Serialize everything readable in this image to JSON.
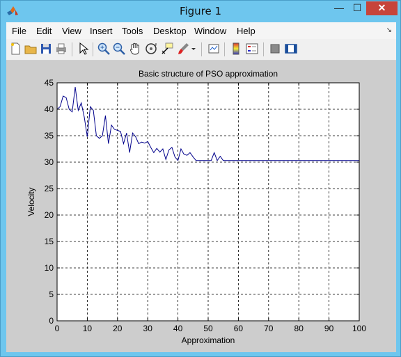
{
  "window": {
    "title": "Figure 1",
    "minimize_glyph": "—",
    "maximize_glyph": "☐",
    "close_glyph": "✕"
  },
  "menu": {
    "items": [
      "File",
      "Edit",
      "View",
      "Insert",
      "Tools",
      "Desktop",
      "Window",
      "Help"
    ],
    "dock_glyph": "↘"
  },
  "toolbar": {
    "icons": [
      "new-figure-icon",
      "open-file-icon",
      "save-icon",
      "print-icon",
      "edit-plot-arrow-icon",
      "zoom-in-icon",
      "zoom-out-icon",
      "pan-hand-icon",
      "rotate-3d-icon",
      "data-cursor-icon",
      "brush-icon",
      "brush-dropdown-icon",
      "link-plot-icon",
      "colorbar-icon",
      "legend-icon",
      "hide-plot-tools-icon",
      "show-plot-tools-icon"
    ]
  },
  "colors": {
    "line": "#00008b",
    "baseline": "#008000",
    "axes_bg": "#ffffff",
    "figure_bg": "#cdcdcd"
  },
  "chart_data": {
    "type": "line",
    "title": "Basic structure of PSO approximation",
    "xlabel": "Approximation",
    "ylabel": "Velocity",
    "xlim": [
      0,
      100
    ],
    "ylim": [
      0,
      45
    ],
    "xticks": [
      0,
      10,
      20,
      30,
      40,
      50,
      60,
      70,
      80,
      90,
      100
    ],
    "yticks": [
      0,
      5,
      10,
      15,
      20,
      25,
      30,
      35,
      40,
      45
    ],
    "grid": true,
    "grid_style": "dashed",
    "series": [
      {
        "color": "#00008b",
        "x": [
          0,
          1,
          2,
          3,
          4,
          5,
          6,
          7,
          8,
          9,
          10,
          11,
          12,
          13,
          14,
          15,
          16,
          17,
          18,
          19,
          20,
          21,
          22,
          23,
          24,
          25,
          26,
          27,
          28,
          29,
          30,
          31,
          32,
          33,
          34,
          35,
          36,
          37,
          38,
          39,
          40,
          41,
          42,
          43,
          44,
          45,
          46,
          47,
          48,
          49,
          50,
          51,
          52,
          53,
          54,
          55,
          56,
          57,
          58,
          59,
          60,
          65,
          70,
          75,
          80,
          85,
          90,
          95,
          100
        ],
        "y": [
          40,
          40.5,
          42.5,
          42.2,
          40,
          39.5,
          44.2,
          39.8,
          41.2,
          38.5,
          34.8,
          40.5,
          39.8,
          35,
          34.5,
          35,
          38.8,
          33.5,
          37,
          36.2,
          36,
          35.8,
          33.5,
          35.5,
          31.8,
          35.5,
          34.8,
          33.5,
          33.8,
          33.6,
          33.9,
          32.8,
          31.8,
          32.6,
          31.9,
          32.5,
          30.5,
          32.3,
          32.8,
          31,
          30.3,
          32.5,
          31.5,
          31.3,
          31.8,
          31,
          30.3,
          30.3,
          30.3,
          30.3,
          30.3,
          30.3,
          31.8,
          30.3,
          31.1,
          30.3,
          30.3,
          30.3,
          30.3,
          30.3,
          30.3,
          30.3,
          30.3,
          30.3,
          30.3,
          30.3,
          30.3,
          30.3,
          30.3
        ]
      },
      {
        "color": "#008000",
        "x": [
          0,
          100
        ],
        "y": [
          0,
          0
        ]
      }
    ]
  }
}
